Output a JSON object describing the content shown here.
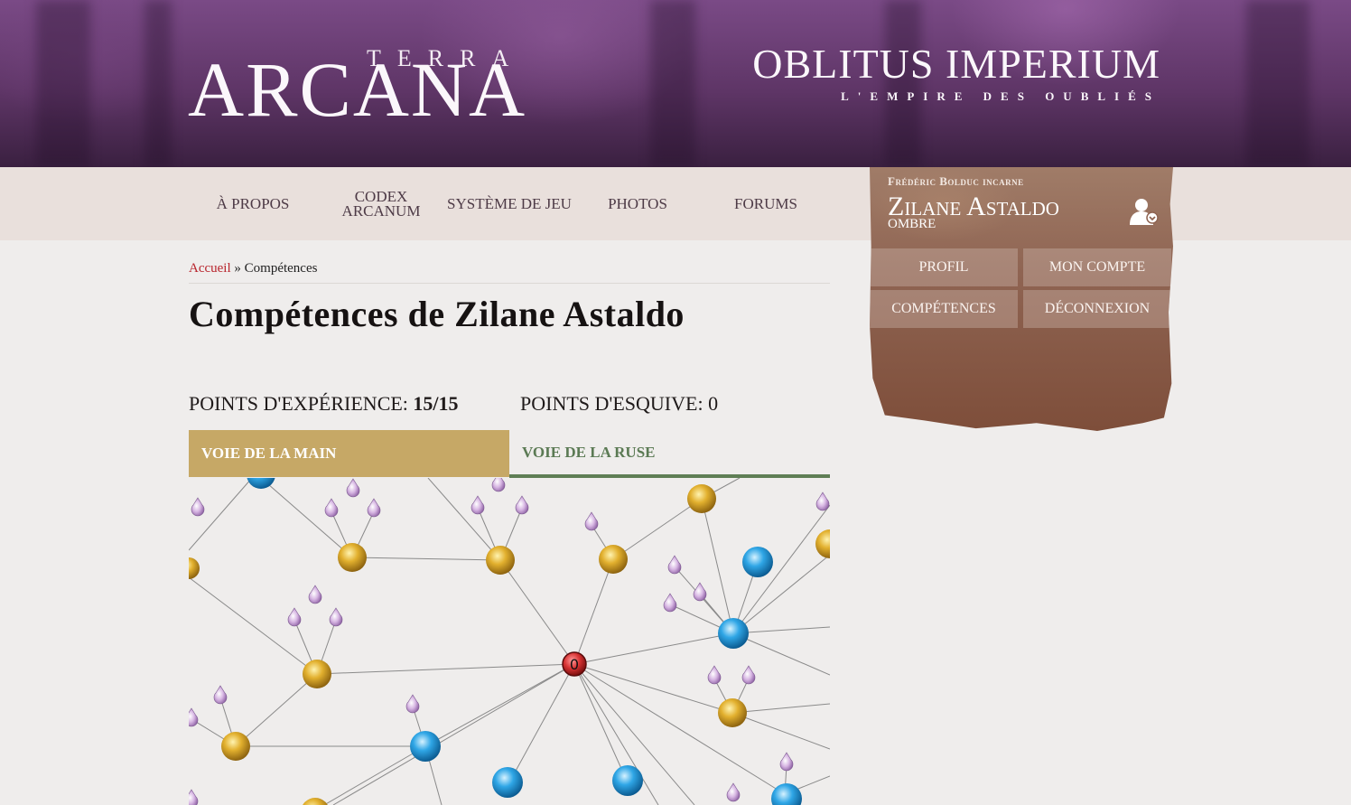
{
  "header": {
    "logo_top": "TERRA",
    "logo_main": "ARCANA",
    "game_title": "OBLITUS IMPERIUM",
    "game_subtitle": "L'EMPIRE DES OUBLIÉS"
  },
  "nav": {
    "items": [
      {
        "label": "À PROPOS"
      },
      {
        "label": "CODEX\nARCANUM"
      },
      {
        "label": "SYSTÈME DE JEU"
      },
      {
        "label": "PHOTOS"
      },
      {
        "label": "FORUMS"
      }
    ]
  },
  "account": {
    "player_line": "Frédéric Bolduc incarne",
    "character_name": "Zilane Astaldo",
    "character_class": "Ombre",
    "buttons": {
      "profile": "PROFIL",
      "my_account": "MON COMPTE",
      "skills": "COMPÉTENCES",
      "logout": "DÉCONNEXION"
    }
  },
  "breadcrumb": {
    "home": "Accueil",
    "separator": "»",
    "current": "Compétences"
  },
  "page": {
    "title": "Compétences de Zilane Astaldo"
  },
  "stats": {
    "xp_label": "POINTS D'EXPÉRIENCE:",
    "xp_value": "15/15",
    "dodge_label": "POINTS D'ESQUIVE:",
    "dodge_value": "0"
  },
  "tabs": {
    "hand": "VOIE DE LA MAIN",
    "ruse": "VOIE DE LA RUSE"
  },
  "skill_tree": {
    "center_label": "0"
  },
  "colors": {
    "accent_red": "#b8242c",
    "tab_gold": "#c6a866",
    "tab_green": "#5f7e55",
    "banner_purple": "#6b3f74"
  }
}
